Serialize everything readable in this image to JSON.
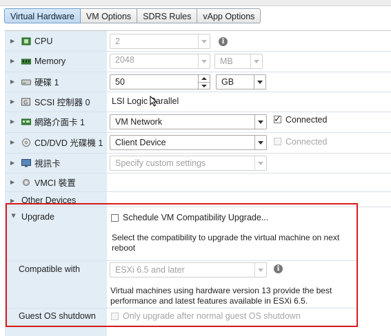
{
  "tabs": [
    {
      "label": "Virtual Hardware",
      "active": true
    },
    {
      "label": "VM Options",
      "active": false
    },
    {
      "label": "SDRS Rules",
      "active": false
    },
    {
      "label": "vApp Options",
      "active": false
    }
  ],
  "hardware": {
    "cpu": {
      "label": "CPU",
      "value": "2"
    },
    "memory": {
      "label": "Memory",
      "value": "2048",
      "unit": "MB"
    },
    "disk": {
      "label": "硬碟 1",
      "value": "50",
      "unit": "GB"
    },
    "scsi": {
      "label": "SCSI 控制器 0",
      "value": "LSI Logic Parallel"
    },
    "nic": {
      "label": "網路介面卡 1",
      "value": "VM Network",
      "connected_label": "Connected",
      "connected": true
    },
    "cdrom": {
      "label": "CD/DVD 光碟機 1",
      "value": "Client Device",
      "connected_label": "Connected",
      "connected": false
    },
    "video": {
      "label": "視訊卡",
      "placeholder": "Specify custom settings"
    },
    "vmci": {
      "label": "VMCI 裝置"
    },
    "other": {
      "label": "Other Devices"
    }
  },
  "upgrade": {
    "label": "Upgrade",
    "schedule_label": "Schedule VM Compatibility Upgrade...",
    "schedule_desc": "Select the compatibility to upgrade the virtual machine on next reboot",
    "compatible_label": "Compatible with",
    "compatible_value": "ESXi 6.5 and later",
    "compatible_desc": "Virtual machines using hardware version 13 provide the best performance and latest features available in ESXi 6.5.",
    "guest_label": "Guest OS shutdown",
    "guest_option": "Only upgrade after normal guest OS shutdown"
  },
  "colors": {
    "highlight_box": "#d71a1a",
    "label_column": "#e2edf5",
    "active_tab": "#c0d9ef"
  }
}
